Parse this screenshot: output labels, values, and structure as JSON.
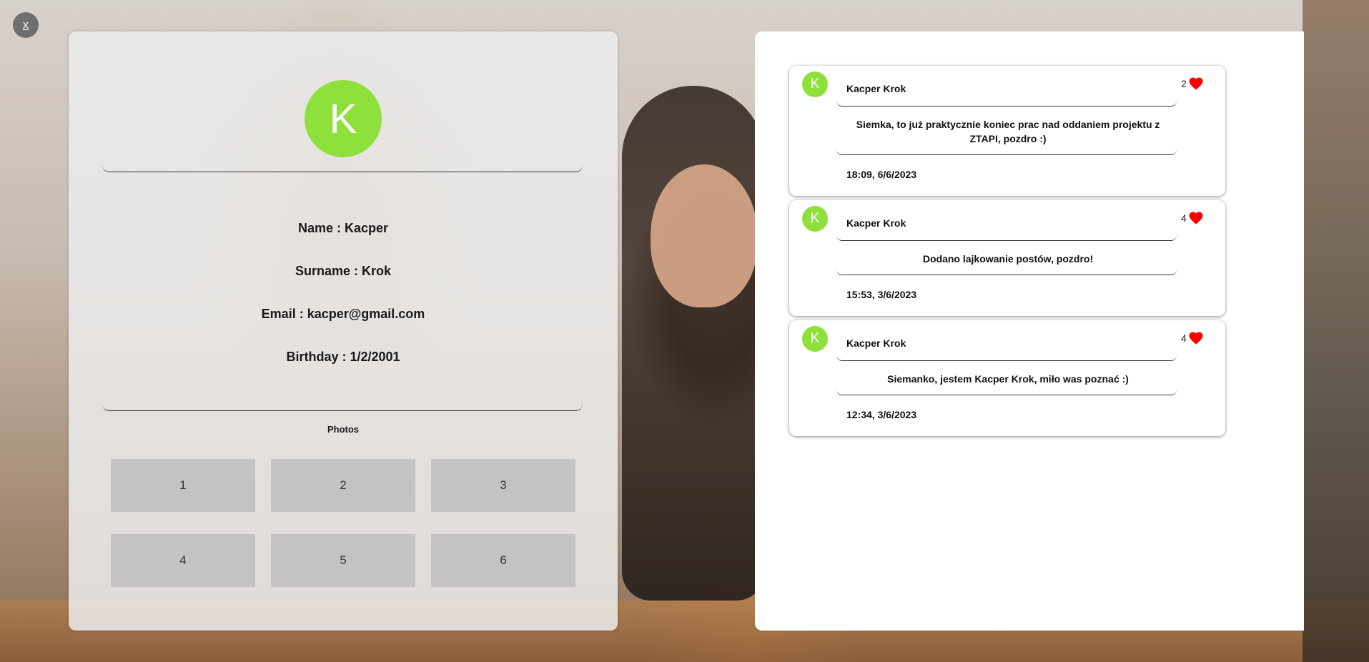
{
  "close_label": "x",
  "profile": {
    "avatar_letter": "K",
    "name_line": "Name : Kacper",
    "surname_line": "Surname : Krok",
    "email_line": "Email : kacper@gmail.com",
    "birthday_line": "Birthday : 1/2/2001",
    "photos_title": "Photos",
    "photos": [
      "1",
      "2",
      "3",
      "4",
      "5",
      "6"
    ]
  },
  "posts": [
    {
      "avatar_letter": "K",
      "author": "Kacper Krok",
      "likes": "2",
      "text": "Siemka, to już praktycznie koniec prac nad oddaniem projektu z ZTAPI, pozdro :)",
      "time": "18:09, 6/6/2023"
    },
    {
      "avatar_letter": "K",
      "author": "Kacper Krok",
      "likes": "4",
      "text": "Dodano lajkowanie postów, pozdro!",
      "time": "15:53, 3/6/2023"
    },
    {
      "avatar_letter": "K",
      "author": "Kacper Krok",
      "likes": "4",
      "text": "Siemanko, jestem Kacper Krok, miło was poznać :)",
      "time": "12:34, 3/6/2023"
    }
  ],
  "colors": {
    "avatar_green": "#8ee03a",
    "heart_red": "#ff0000"
  }
}
